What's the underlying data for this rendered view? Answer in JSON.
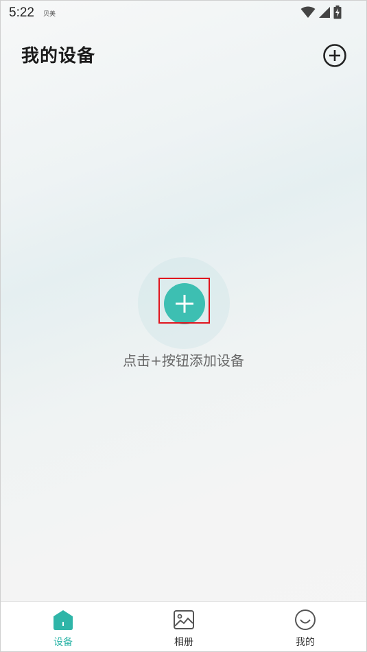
{
  "status_bar": {
    "time": "5:22",
    "carrier": "贝美",
    "icons": [
      "wifi-icon",
      "signal-icon",
      "battery-charging-icon"
    ]
  },
  "header": {
    "title": "我的设备",
    "add_icon": "add-circle-icon"
  },
  "empty_state": {
    "add_icon": "add-icon",
    "hint": "点击+按钮添加设备"
  },
  "bottom_nav": {
    "items": [
      {
        "label": "设备",
        "icon": "home-icon",
        "active": true
      },
      {
        "label": "相册",
        "icon": "image-icon",
        "active": false
      },
      {
        "label": "我的",
        "icon": "smile-icon",
        "active": false
      }
    ]
  },
  "colors": {
    "accent": "#3dbfb2",
    "highlight": "#e0141d"
  }
}
